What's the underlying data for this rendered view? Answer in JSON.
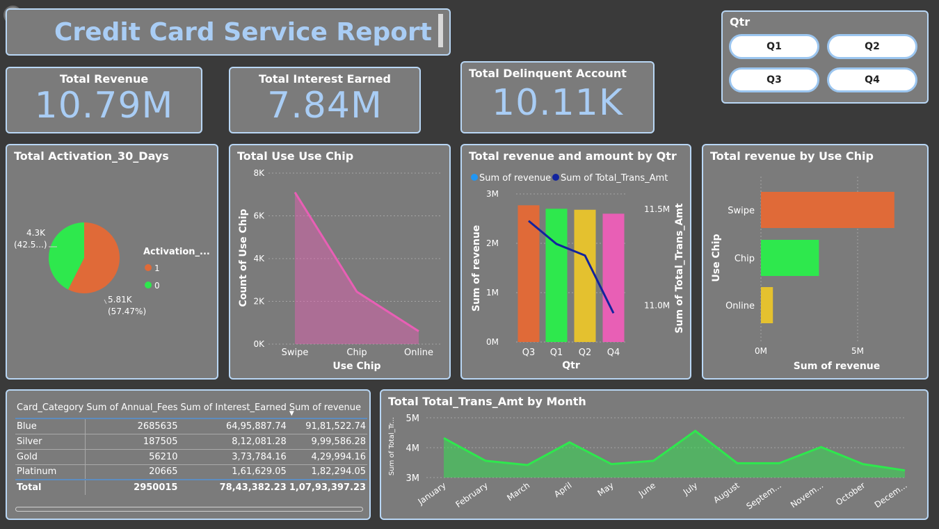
{
  "title": "Credit Card Service Report",
  "kpis": {
    "revenue": {
      "label": "Total Revenue",
      "value": "10.79M"
    },
    "interest": {
      "label": "Total Interest Earned",
      "value": "7.84M"
    },
    "delinquent": {
      "label": "Total Delinquent Account",
      "value": "10.11K"
    }
  },
  "slicer": {
    "title": "Qtr",
    "options": [
      "Q1",
      "Q2",
      "Q3",
      "Q4"
    ]
  },
  "activation": {
    "title": "Total Activation_30_Days",
    "legend_title": "Activation_...",
    "legend": [
      {
        "label": "1",
        "color": "#e06a38"
      },
      {
        "label": "0",
        "color": "#2ee84d"
      }
    ],
    "label_1a": "4.3K",
    "label_1b": "(42.5...)",
    "label_2a": "5.81K",
    "label_2b": "(57.47%)"
  },
  "chip_area": {
    "title": "Total Use Use Chip",
    "xlabel": "Use Chip",
    "ylabel": "Count of Use Chip"
  },
  "rev_qtr": {
    "title": "Total revenue and amount by Qtr",
    "legend": [
      {
        "label": "Sum of revenue",
        "color": "#2196f3"
      },
      {
        "label": "Sum of Total_Trans_Amt",
        "color": "#12239e"
      }
    ],
    "xlabel": "Qtr",
    "ylabel": "Sum of revenue",
    "y2label": "Sum of Total_Trans_Amt"
  },
  "rev_chip": {
    "title": "Total revenue by Use Chip",
    "xlabel": "Sum of revenue",
    "ylabel": "Use Chip"
  },
  "month_chart": {
    "title": "Total Total_Trans_Amt by Month",
    "ylabel": "Sum of Total_Tr..."
  },
  "table": {
    "headers": [
      "Card_Category",
      "Sum of Annual_Fees",
      "Sum of Interest_Earned",
      "Sum of revenue"
    ],
    "rows": [
      [
        "Blue",
        "2685635",
        "64,95,887.74",
        "91,81,522.74"
      ],
      [
        "Silver",
        "187505",
        "8,12,081.28",
        "9,99,586.28"
      ],
      [
        "Gold",
        "56210",
        "3,73,784.16",
        "4,29,994.16"
      ],
      [
        "Platinum",
        "20665",
        "1,61,629.05",
        "1,82,294.05"
      ]
    ],
    "total": [
      "Total",
      "2950015",
      "78,43,382.23",
      "1,07,93,397.23"
    ]
  },
  "chart_data": [
    {
      "type": "pie",
      "title": "Total Activation_30_Days",
      "categories": [
        "1",
        "0"
      ],
      "values": [
        5810,
        4300
      ],
      "colors": [
        "#e06a38",
        "#2ee84d"
      ]
    },
    {
      "type": "area",
      "title": "Total Use Use Chip",
      "categories": [
        "Swipe",
        "Chip",
        "Online"
      ],
      "values": [
        7100,
        2450,
        600
      ],
      "yticks": [
        "0K",
        "2K",
        "4K",
        "6K",
        "8K"
      ],
      "ylim": [
        0,
        8000
      ],
      "color": "#e85fb5"
    },
    {
      "type": "bar",
      "title": "Total revenue and amount by Qtr",
      "categories": [
        "Q3",
        "Q1",
        "Q2",
        "Q4"
      ],
      "series": [
        {
          "name": "Sum of revenue",
          "values": [
            2770000,
            2700000,
            2680000,
            2600000
          ],
          "ylim": [
            0,
            3000000
          ]
        },
        {
          "name": "Sum of Total_Trans_Amt",
          "values": [
            11440000,
            11320000,
            11260000,
            10960000
          ],
          "ylim": [
            10810000,
            11580000
          ]
        }
      ],
      "bar_colors": [
        "#e06a38",
        "#2ee84d",
        "#e4c12f",
        "#e85fb5"
      ],
      "yticks": [
        "0M",
        "1M",
        "2M",
        "3M"
      ],
      "y2ticks": [
        "11.0M",
        "11.5M"
      ]
    },
    {
      "type": "bar",
      "title": "Total revenue by Use Chip",
      "orientation": "horizontal",
      "categories": [
        "Swipe",
        "Chip",
        "Online"
      ],
      "values": [
        6900000,
        3000000,
        620000
      ],
      "colors": [
        "#e06a38",
        "#2ee84d",
        "#e4c12f"
      ],
      "xticks": [
        "0M",
        "5M"
      ]
    },
    {
      "type": "area",
      "title": "Total Total_Trans_Amt by Month",
      "categories": [
        "January",
        "February",
        "March",
        "April",
        "May",
        "June",
        "July",
        "August",
        "Septem...",
        "Novem...",
        "October",
        "Decem..."
      ],
      "values": [
        4320000,
        3560000,
        3420000,
        4180000,
        3450000,
        3560000,
        4560000,
        3480000,
        3480000,
        4020000,
        3450000,
        3240000
      ],
      "ylim": [
        3000000,
        5000000
      ],
      "yticks": [
        "3M",
        "4M",
        "5M"
      ],
      "color": "#2ee84d"
    }
  ]
}
